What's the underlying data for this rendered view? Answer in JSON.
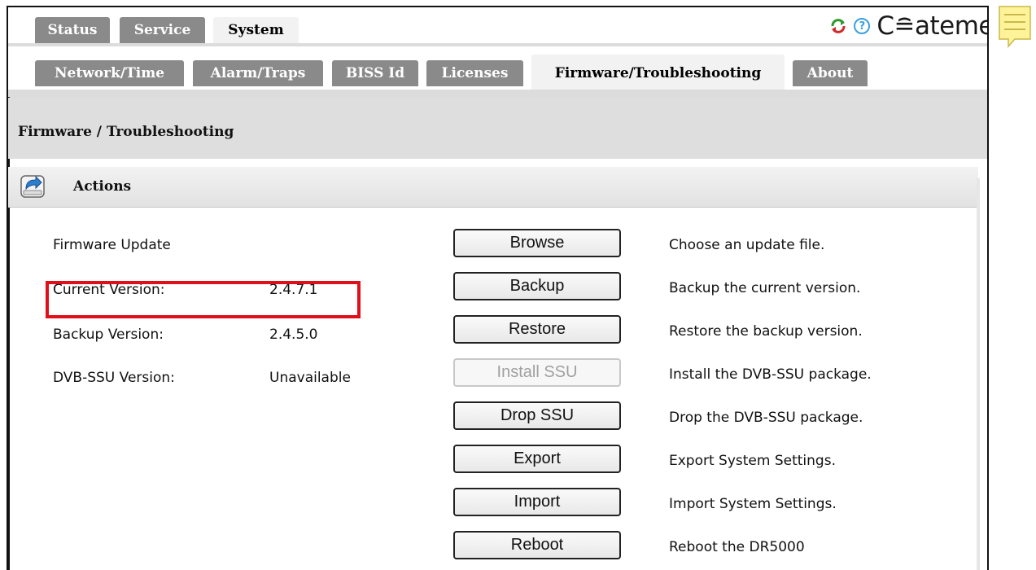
{
  "tabs_row1": [
    {
      "label": "Status",
      "active": false
    },
    {
      "label": "Service",
      "active": false
    },
    {
      "label": "System",
      "active": true
    }
  ],
  "tabs_row2": [
    {
      "label": "Network/Time",
      "active": false
    },
    {
      "label": "Alarm/Traps",
      "active": false
    },
    {
      "label": "BISS Id",
      "active": false
    },
    {
      "label": "Licenses",
      "active": false
    },
    {
      "label": "Firmware/Troubleshooting",
      "active": true
    },
    {
      "label": "About",
      "active": false
    }
  ],
  "header": {
    "help_glyph": "?",
    "logo_text": "C≘ateme",
    "icons": [
      "refresh-icon",
      "help-icon",
      "note-icon"
    ]
  },
  "page": {
    "title": "Firmware / Troubleshooting"
  },
  "actions": {
    "title": "Actions",
    "icon": "actions-icon",
    "info_rows": [
      {
        "label": "Firmware Update",
        "value": ""
      },
      {
        "label": "Current Version:",
        "value": "2.4.7.1",
        "highlighted": true
      },
      {
        "label": "Backup Version:",
        "value": "2.4.5.0"
      },
      {
        "label": "DVB-SSU Version:",
        "value": "Unavailable"
      }
    ],
    "buttons": [
      {
        "label": "Browse",
        "enabled": true,
        "description": "Choose an update file."
      },
      {
        "label": "Backup",
        "enabled": true,
        "description": "Backup the current version."
      },
      {
        "label": "Restore",
        "enabled": true,
        "description": "Restore the backup version."
      },
      {
        "label": "Install SSU",
        "enabled": false,
        "description": "Install the DVB-SSU package."
      },
      {
        "label": "Drop SSU",
        "enabled": true,
        "description": "Drop the DVB-SSU package."
      },
      {
        "label": "Export",
        "enabled": true,
        "description": "Export System Settings."
      },
      {
        "label": "Import",
        "enabled": true,
        "description": "Import System Settings."
      },
      {
        "label": "Reboot",
        "enabled": true,
        "description": "Reboot the DR5000"
      }
    ]
  },
  "colors": {
    "tab_dark": "#8a8a8a",
    "highlight_border": "#e0101a",
    "help_blue": "#3aa0e0",
    "note_yellow": "#fff39a"
  }
}
